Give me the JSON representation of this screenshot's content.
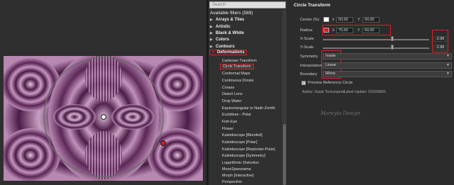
{
  "search": {
    "placeholder": "Search"
  },
  "filters": {
    "heading": "Available filters (589)",
    "categories": [
      {
        "label": "Arrays & Tiles",
        "arrow": "▶"
      },
      {
        "label": "Artistic",
        "arrow": "▶"
      },
      {
        "label": "Black & White",
        "arrow": "▶"
      },
      {
        "label": "Colors",
        "arrow": "▶"
      },
      {
        "label": "Contours",
        "arrow": "▶"
      },
      {
        "label": "Deformations",
        "arrow": "▼"
      }
    ],
    "items": [
      "Cartesian Transform",
      "Circle Transform",
      "Conformal Maps",
      "Continuous Droste",
      "Crease",
      "Distort Lens",
      "Drop Water",
      "Equirectangular to Nadir-Zenith",
      "Euclidean - Polar",
      "Fish-Eye",
      "Flower",
      "Kaleidoscope [Blended]",
      "Kaleidoscope [Polar]",
      "Kaleidoscope [Reptorian-Polar]",
      "Kaleidoscope [Symmetry]",
      "Logarithmic Distortion",
      "Moon2panorama",
      "Morph [Interactive]",
      "Perspective"
    ]
  },
  "settings": {
    "title": "Circle Transform",
    "center": {
      "label": "Center (%)",
      "x_label": "X",
      "x": "50,00",
      "y_label": "Y",
      "y": "50,00",
      "color": "#ffffff"
    },
    "radius": {
      "label": "Radius",
      "x_label": "X",
      "x": "75,00",
      "y_label": "Y",
      "y": "60,00",
      "color": "#d81f1f"
    },
    "x_scale": {
      "label": "X-Scale",
      "value": "-2.88",
      "fraction": 0.65
    },
    "y_scale": {
      "label": "Y-Scale",
      "value": "-2.88",
      "fraction": 0.65
    },
    "symmetry": {
      "label": "Symmetry",
      "value": "Inside"
    },
    "interpolation": {
      "label": "Interpolation",
      "value": "Linear"
    },
    "boundary": {
      "label": "Boundary",
      "value": "Mirror"
    },
    "preview_reference": {
      "label": "Preview Reference Circle",
      "checked": "✓"
    },
    "author": {
      "prefix": "Author:",
      "name": "David Tschumperlé",
      "version_label": "Latest Update:",
      "version": "2015/08/01."
    }
  },
  "watermark": {
    "text": "Mareyia Design"
  },
  "colors": {
    "highlight": "#d3242b",
    "purple_dark": "#3c1438",
    "purple_light": "#d7a9cf"
  }
}
